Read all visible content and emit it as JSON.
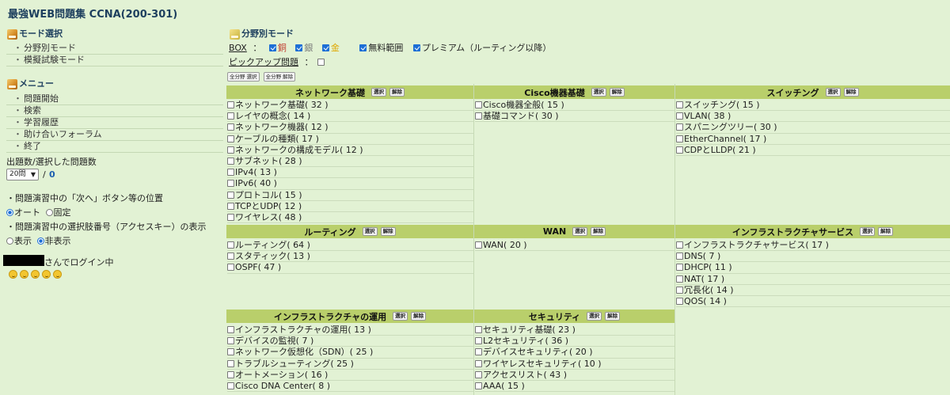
{
  "site_title": "最強WEB問題集 CCNA(200-301)",
  "sidebar": {
    "mode_head": "モード選択",
    "mode_items": [
      "分野別モード",
      "模擬試験モード"
    ],
    "menu_head": "メニュー",
    "menu_items": [
      "問題開始",
      "検索",
      "学習履歴",
      "助け合いフォーラム",
      "終了"
    ],
    "count_label": "出題数/選択した問題数",
    "count_select": "20問",
    "count_slash": "/",
    "count_value": "0",
    "next_btn_label": "・問題演習中の「次へ」ボタン等の位置",
    "next_opt_auto": "オート",
    "next_opt_fixed": "固定",
    "access_label": "・問題演習中の選択肢番号（アクセスキー）の表示",
    "access_opt_show": "表示",
    "access_opt_hide": "非表示",
    "login_suffix": "さんでログイン中"
  },
  "main": {
    "head": "分野別モード",
    "box_label": "BOX",
    "box_colon": "：",
    "box_copper": "銅",
    "box_silver": "銀",
    "box_gold": "金",
    "free": "無料範囲",
    "premium": "プレミアム（ルーティング以降）",
    "pickup_label": "ピックアップ問題",
    "pickup_colon": "：",
    "all_select": "全分野 選択",
    "all_clear": "全分野 解除",
    "select": "選択",
    "clear": "解除"
  },
  "colors": {
    "background": "#e2f2d4",
    "header_bar": "#b9cf6b",
    "copper": "#c0392b",
    "silver": "#7a7a7a",
    "gold": "#e0a800",
    "title": "#1d3f5e"
  },
  "categories": [
    {
      "title": "ネットワーク基礎",
      "items": [
        "ネットワーク基礎( 32 )",
        "レイヤの概念( 14 )",
        "ネットワーク機器( 12 )",
        "ケーブルの種類( 17 )",
        "ネットワークの構成モデル( 12 )",
        "サブネット( 28 )",
        "IPv4( 13 )",
        "IPv6( 40 )",
        "プロトコル( 15 )",
        "TCPとUDP( 12 )",
        "ワイヤレス( 48 )"
      ]
    },
    {
      "title": "Cisco機器基礎",
      "items": [
        "Cisco機器全般( 15 )",
        "基礎コマンド( 30 )"
      ]
    },
    {
      "title": "スイッチング",
      "items": [
        "スイッチング( 15 )",
        "VLAN( 38 )",
        "スパニングツリー( 30 )",
        "EtherChannel( 17 )",
        "CDPとLLDP( 21 )"
      ]
    },
    {
      "title": "ルーティング",
      "items": [
        "ルーティング( 64 )",
        "スタティック( 13 )",
        "OSPF( 47 )"
      ]
    },
    {
      "title": "WAN",
      "items": [
        "WAN( 20 )"
      ]
    },
    {
      "title": "インフラストラクチャサービス",
      "items": [
        "インフラストラクチャサービス( 17 )",
        "DNS( 7 )",
        "DHCP( 11 )",
        "NAT( 17 )",
        "冗長化( 14 )",
        "QOS( 14 )"
      ]
    },
    {
      "title": "インフラストラクチャの運用",
      "items": [
        "インフラストラクチャの運用( 13 )",
        "デバイスの監視( 7 )",
        "ネットワーク仮想化（SDN）( 25 )",
        "トラブルシューティング( 25 )",
        "オートメーション( 16 )",
        "Cisco DNA Center( 8 )"
      ]
    },
    {
      "title": "セキュリティ",
      "items": [
        "セキュリティ基礎( 23 )",
        "L2セキュリティ( 36 )",
        "デバイスセキュリティ( 20 )",
        "ワイヤレスセキュリティ( 10 )",
        "アクセスリスト( 43 )",
        "AAA( 15 )"
      ]
    }
  ]
}
